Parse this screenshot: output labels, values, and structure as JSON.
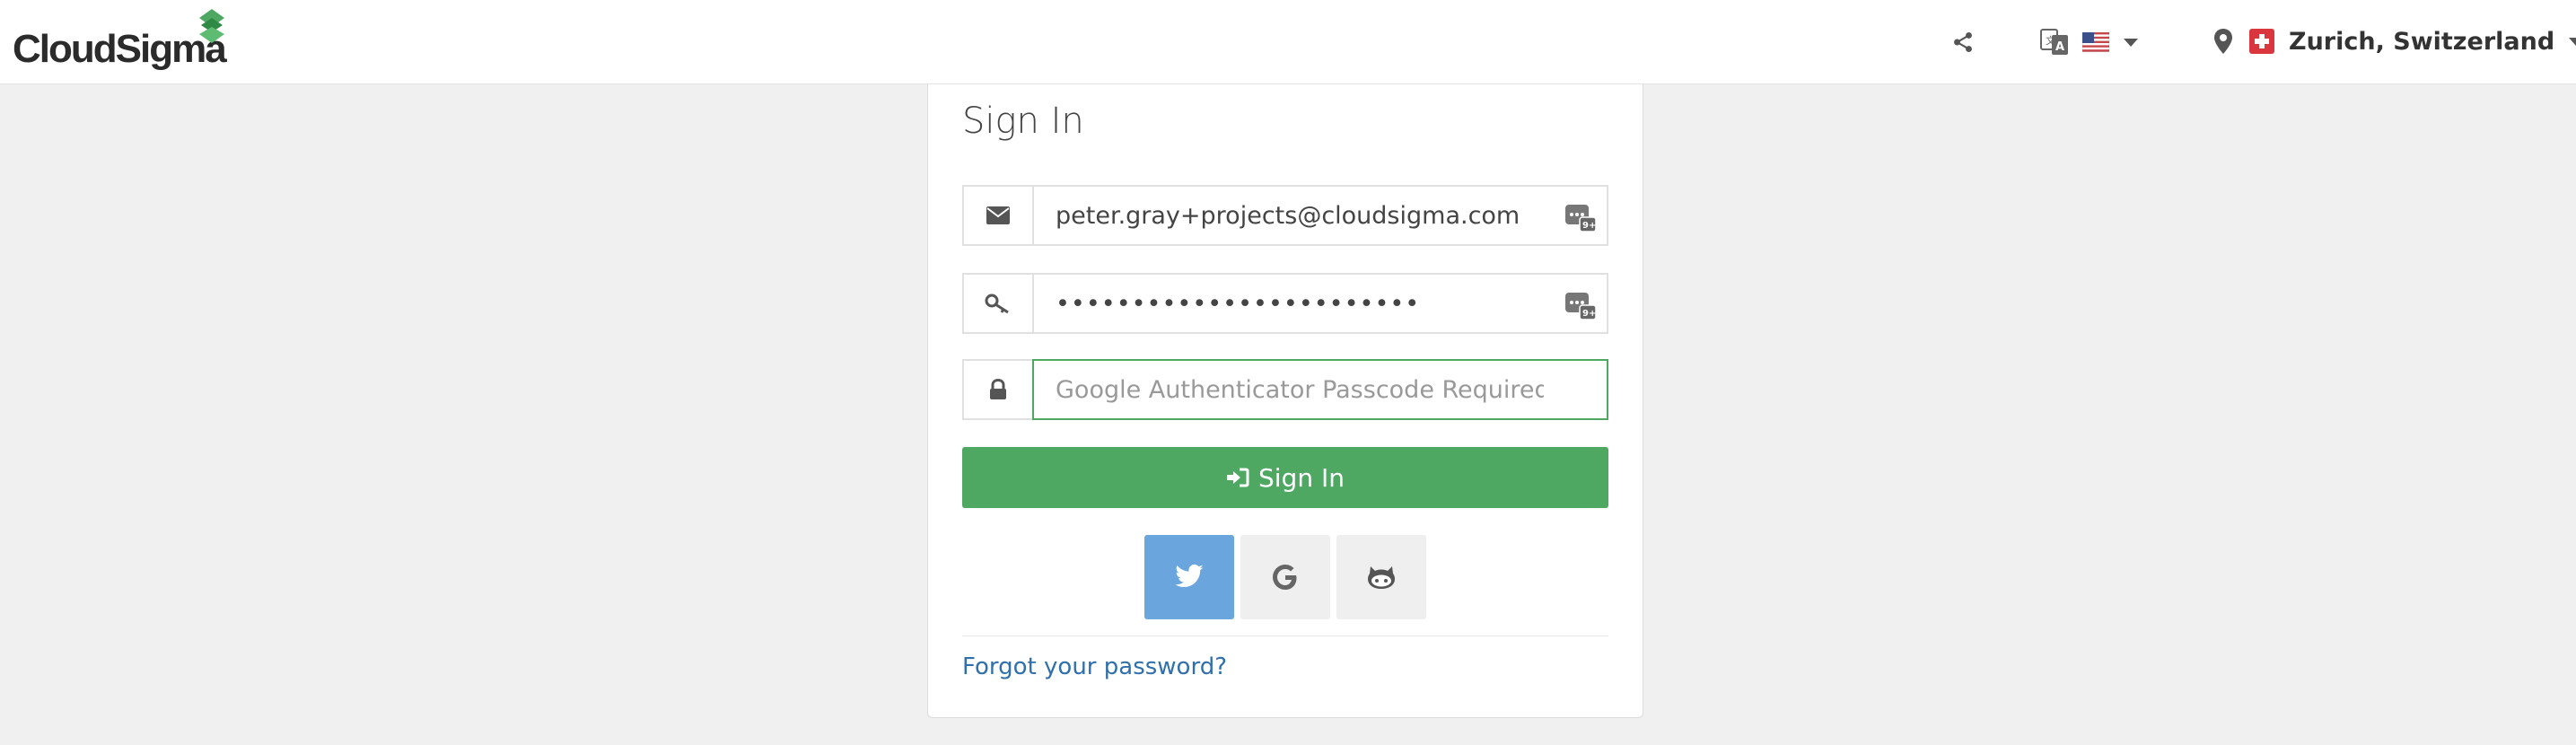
{
  "header": {
    "logo_text": "CloudSigma",
    "location_label": "Zurich, Switzerland",
    "language_flag": "us-flag-icon",
    "location_flag": "switzerland-flag-icon"
  },
  "signin": {
    "title": "Sign In",
    "email_value": "peter.gray+projects@cloudsigma.com",
    "password_value": "••••••••••••••••••••••••",
    "otp_placeholder": "Google Authenticator Passcode Required",
    "submit_label": "Sign In",
    "forgot_link": "Forgot your password?"
  },
  "colors": {
    "primary_green": "#4ea862",
    "twitter_blue": "#6aa6dd",
    "link_blue": "#2f6fab"
  }
}
